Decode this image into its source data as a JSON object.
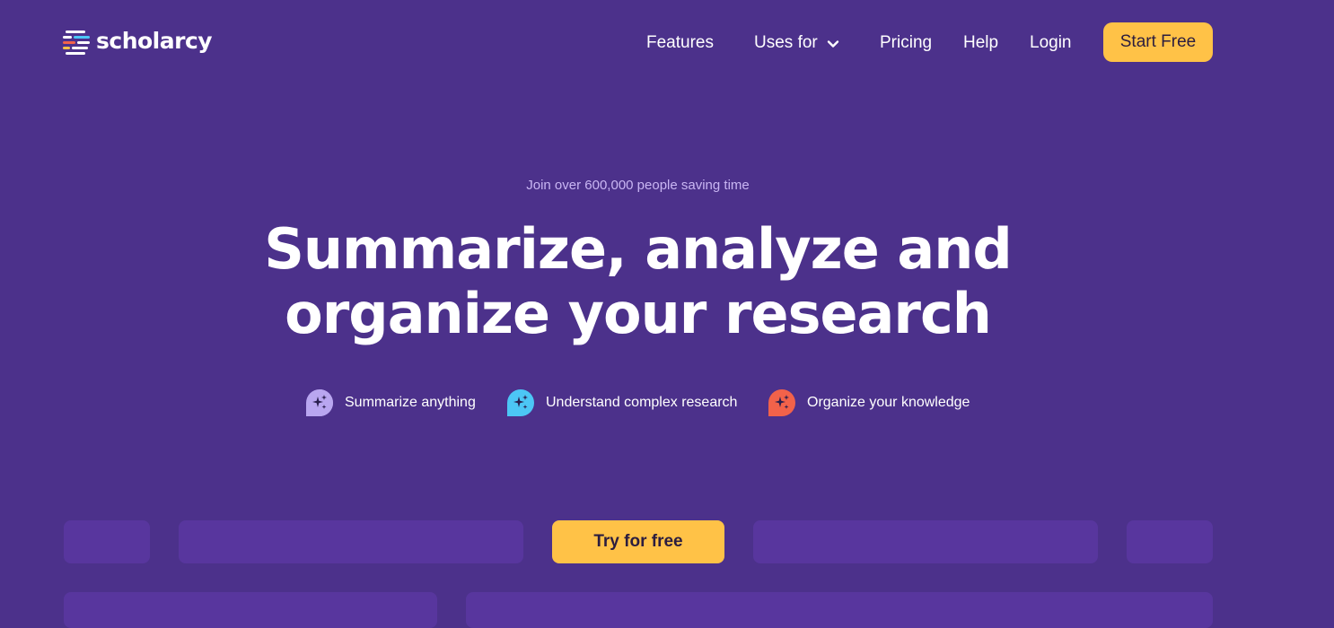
{
  "brand": {
    "name": "scholarcy"
  },
  "nav": {
    "features": "Features",
    "uses_for": "Uses for",
    "pricing": "Pricing",
    "help": "Help",
    "login": "Login",
    "start_free": "Start Free"
  },
  "hero": {
    "eyebrow": "Join over 600,000 people saving time",
    "headline_line1": "Summarize, analyze and",
    "headline_line2": "organize your research",
    "features": [
      {
        "label": "Summarize anything",
        "icon": "sparkle-bubble-icon",
        "color": "#b9a6f0"
      },
      {
        "label": "Understand complex research",
        "icon": "sparkle-bubble-icon",
        "color": "#4cc6f5"
      },
      {
        "label": "Organize your knowledge",
        "icon": "sparkle-bubble-icon",
        "color": "#f2624a"
      }
    ],
    "cta": "Try for free"
  },
  "colors": {
    "background": "#4c318b",
    "accent": "#ffc247",
    "placeholder": "#58369e",
    "eyebrow_text": "#c9b6f3"
  }
}
